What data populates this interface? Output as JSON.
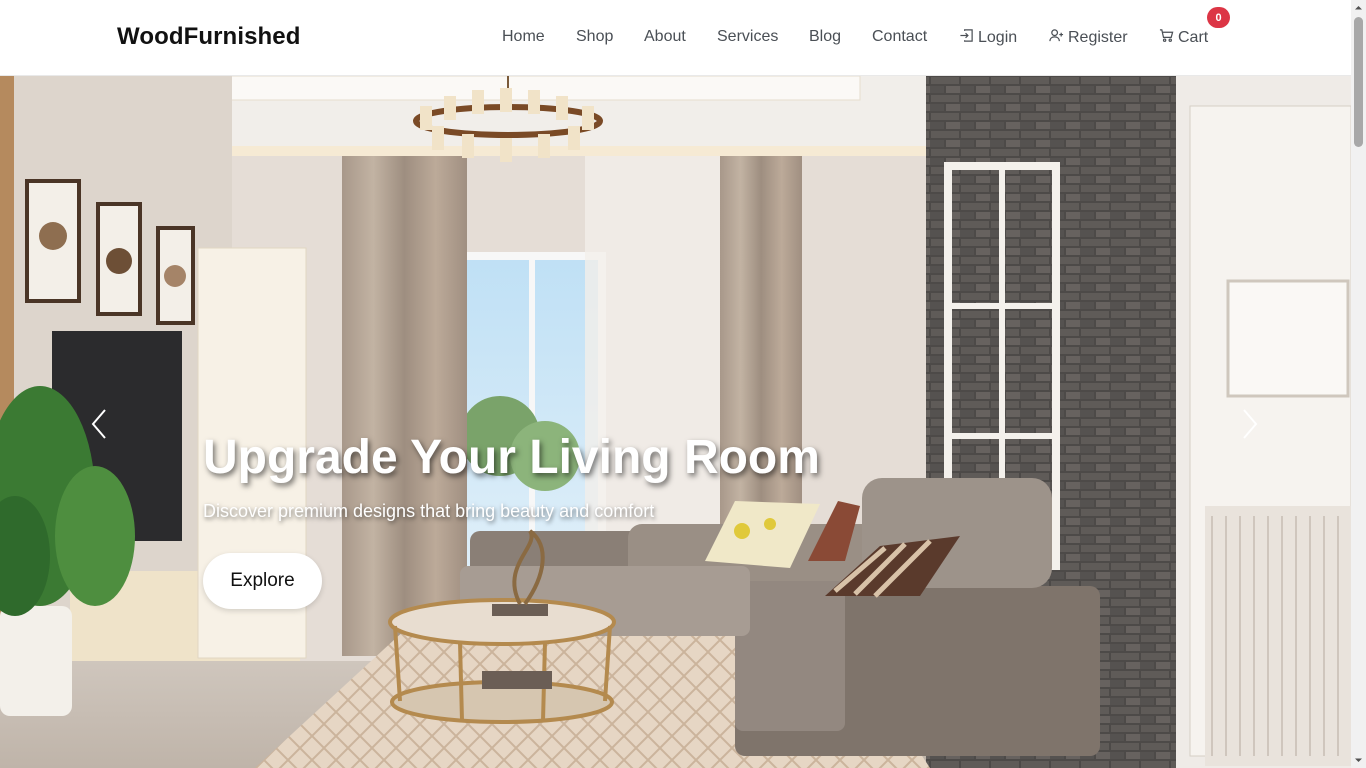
{
  "brand": {
    "name": "WoodFurnished"
  },
  "nav": {
    "home": "Home",
    "shop": "Shop",
    "about": "About",
    "services": "Services",
    "blog": "Blog",
    "contact": "Contact",
    "login": "Login",
    "register": "Register",
    "cart": "Cart",
    "cart_count": "0"
  },
  "hero": {
    "title": "Upgrade Your Living Room",
    "subtitle": "Discover premium designs that bring beauty and comfort",
    "cta": "Explore"
  },
  "icons": {
    "login": "login-icon",
    "register": "user-plus-icon",
    "cart": "cart-icon",
    "prev": "chevron-left-icon",
    "next": "chevron-right-icon"
  },
  "colors": {
    "badge": "#dc3545",
    "nav_text": "#4a4f55",
    "brand_text": "#111111"
  }
}
